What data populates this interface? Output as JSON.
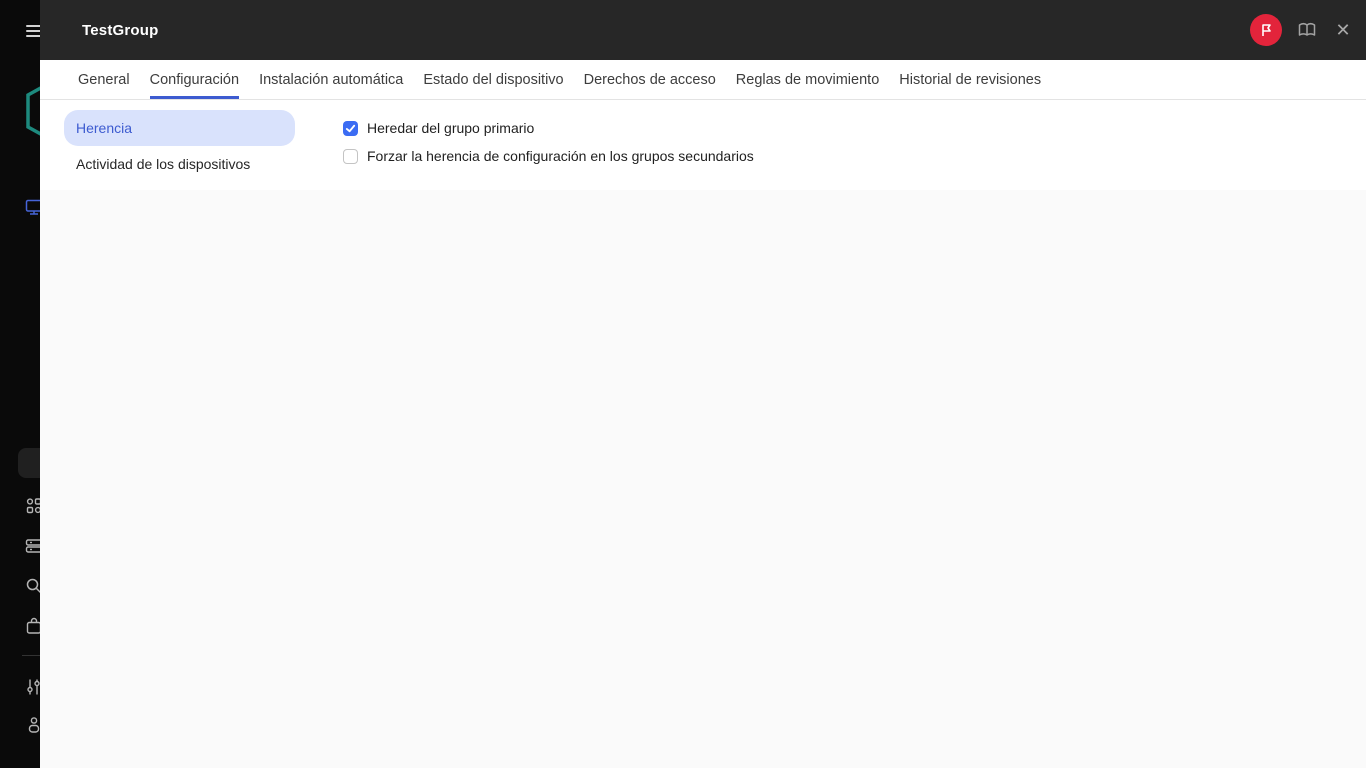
{
  "header": {
    "title": "TestGroup",
    "icons": {
      "badge": "flag-icon",
      "help": "open-book-icon",
      "close": "close-icon"
    }
  },
  "tabs": {
    "items": [
      {
        "label": "General",
        "active": false
      },
      {
        "label": "Configuración",
        "active": true
      },
      {
        "label": "Instalación automática",
        "active": false
      },
      {
        "label": "Estado del dispositivo",
        "active": false
      },
      {
        "label": "Derechos de acceso",
        "active": false
      },
      {
        "label": "Reglas de movimiento",
        "active": false
      },
      {
        "label": "Historial de revisiones",
        "active": false
      }
    ]
  },
  "subnav": {
    "items": [
      {
        "label": "Herencia",
        "active": true
      },
      {
        "label": "Actividad de los dispositivos",
        "active": false
      }
    ]
  },
  "settings": {
    "checkboxes": [
      {
        "label": "Heredar del grupo primario",
        "checked": true
      },
      {
        "label": "Forzar la herencia de configuración en los grupos secundarios",
        "checked": false
      }
    ]
  },
  "sidebar": {
    "icons": [
      "menu-icon",
      "kaspersky-logo-icon",
      "monitor-icon",
      "people-group-icon",
      "server-stack-icon",
      "search-icon",
      "bag-icon",
      "sliders-icon",
      "user-icon"
    ]
  },
  "colors": {
    "sidebar_bg": "#0a0a0a",
    "header_bg": "#272727",
    "badge_red": "#e3243b",
    "accent_blue": "#3d5bd0",
    "checkbox_blue": "#3b6cf3",
    "pill_bg": "#d9e2fc",
    "logo_teal": "#1d8a7e",
    "sidebar_icon_gray": "#b5b5b5"
  }
}
